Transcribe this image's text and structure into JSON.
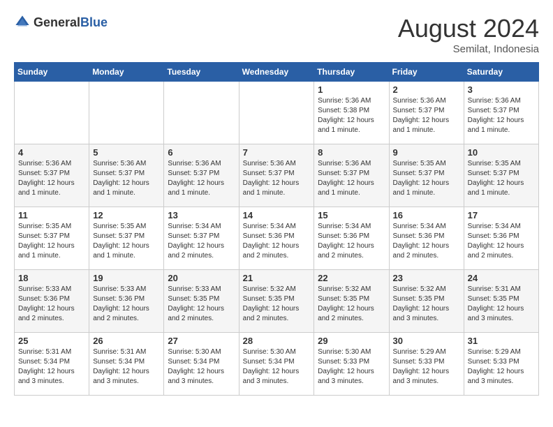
{
  "header": {
    "logo_general": "General",
    "logo_blue": "Blue",
    "month_year": "August 2024",
    "location": "Semilat, Indonesia"
  },
  "days_of_week": [
    "Sunday",
    "Monday",
    "Tuesday",
    "Wednesday",
    "Thursday",
    "Friday",
    "Saturday"
  ],
  "weeks": [
    [
      {
        "day": "",
        "info": ""
      },
      {
        "day": "",
        "info": ""
      },
      {
        "day": "",
        "info": ""
      },
      {
        "day": "",
        "info": ""
      },
      {
        "day": "1",
        "info": "Sunrise: 5:36 AM\nSunset: 5:38 PM\nDaylight: 12 hours\nand 1 minute."
      },
      {
        "day": "2",
        "info": "Sunrise: 5:36 AM\nSunset: 5:37 PM\nDaylight: 12 hours\nand 1 minute."
      },
      {
        "day": "3",
        "info": "Sunrise: 5:36 AM\nSunset: 5:37 PM\nDaylight: 12 hours\nand 1 minute."
      }
    ],
    [
      {
        "day": "4",
        "info": "Sunrise: 5:36 AM\nSunset: 5:37 PM\nDaylight: 12 hours\nand 1 minute."
      },
      {
        "day": "5",
        "info": "Sunrise: 5:36 AM\nSunset: 5:37 PM\nDaylight: 12 hours\nand 1 minute."
      },
      {
        "day": "6",
        "info": "Sunrise: 5:36 AM\nSunset: 5:37 PM\nDaylight: 12 hours\nand 1 minute."
      },
      {
        "day": "7",
        "info": "Sunrise: 5:36 AM\nSunset: 5:37 PM\nDaylight: 12 hours\nand 1 minute."
      },
      {
        "day": "8",
        "info": "Sunrise: 5:36 AM\nSunset: 5:37 PM\nDaylight: 12 hours\nand 1 minute."
      },
      {
        "day": "9",
        "info": "Sunrise: 5:35 AM\nSunset: 5:37 PM\nDaylight: 12 hours\nand 1 minute."
      },
      {
        "day": "10",
        "info": "Sunrise: 5:35 AM\nSunset: 5:37 PM\nDaylight: 12 hours\nand 1 minute."
      }
    ],
    [
      {
        "day": "11",
        "info": "Sunrise: 5:35 AM\nSunset: 5:37 PM\nDaylight: 12 hours\nand 1 minute."
      },
      {
        "day": "12",
        "info": "Sunrise: 5:35 AM\nSunset: 5:37 PM\nDaylight: 12 hours\nand 1 minute."
      },
      {
        "day": "13",
        "info": "Sunrise: 5:34 AM\nSunset: 5:37 PM\nDaylight: 12 hours\nand 2 minutes."
      },
      {
        "day": "14",
        "info": "Sunrise: 5:34 AM\nSunset: 5:36 PM\nDaylight: 12 hours\nand 2 minutes."
      },
      {
        "day": "15",
        "info": "Sunrise: 5:34 AM\nSunset: 5:36 PM\nDaylight: 12 hours\nand 2 minutes."
      },
      {
        "day": "16",
        "info": "Sunrise: 5:34 AM\nSunset: 5:36 PM\nDaylight: 12 hours\nand 2 minutes."
      },
      {
        "day": "17",
        "info": "Sunrise: 5:34 AM\nSunset: 5:36 PM\nDaylight: 12 hours\nand 2 minutes."
      }
    ],
    [
      {
        "day": "18",
        "info": "Sunrise: 5:33 AM\nSunset: 5:36 PM\nDaylight: 12 hours\nand 2 minutes."
      },
      {
        "day": "19",
        "info": "Sunrise: 5:33 AM\nSunset: 5:36 PM\nDaylight: 12 hours\nand 2 minutes."
      },
      {
        "day": "20",
        "info": "Sunrise: 5:33 AM\nSunset: 5:35 PM\nDaylight: 12 hours\nand 2 minutes."
      },
      {
        "day": "21",
        "info": "Sunrise: 5:32 AM\nSunset: 5:35 PM\nDaylight: 12 hours\nand 2 minutes."
      },
      {
        "day": "22",
        "info": "Sunrise: 5:32 AM\nSunset: 5:35 PM\nDaylight: 12 hours\nand 2 minutes."
      },
      {
        "day": "23",
        "info": "Sunrise: 5:32 AM\nSunset: 5:35 PM\nDaylight: 12 hours\nand 3 minutes."
      },
      {
        "day": "24",
        "info": "Sunrise: 5:31 AM\nSunset: 5:35 PM\nDaylight: 12 hours\nand 3 minutes."
      }
    ],
    [
      {
        "day": "25",
        "info": "Sunrise: 5:31 AM\nSunset: 5:34 PM\nDaylight: 12 hours\nand 3 minutes."
      },
      {
        "day": "26",
        "info": "Sunrise: 5:31 AM\nSunset: 5:34 PM\nDaylight: 12 hours\nand 3 minutes."
      },
      {
        "day": "27",
        "info": "Sunrise: 5:30 AM\nSunset: 5:34 PM\nDaylight: 12 hours\nand 3 minutes."
      },
      {
        "day": "28",
        "info": "Sunrise: 5:30 AM\nSunset: 5:34 PM\nDaylight: 12 hours\nand 3 minutes."
      },
      {
        "day": "29",
        "info": "Sunrise: 5:30 AM\nSunset: 5:33 PM\nDaylight: 12 hours\nand 3 minutes."
      },
      {
        "day": "30",
        "info": "Sunrise: 5:29 AM\nSunset: 5:33 PM\nDaylight: 12 hours\nand 3 minutes."
      },
      {
        "day": "31",
        "info": "Sunrise: 5:29 AM\nSunset: 5:33 PM\nDaylight: 12 hours\nand 3 minutes."
      }
    ]
  ]
}
